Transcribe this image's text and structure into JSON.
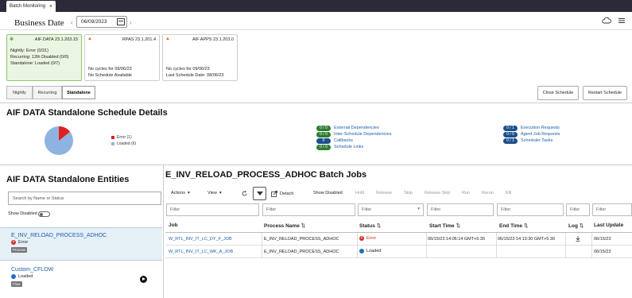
{
  "tab": {
    "title": "Batch Monitoring"
  },
  "header": {
    "title": "Business Date",
    "date": "06/09/2023"
  },
  "cards": [
    {
      "title": "AIF DATA 23.1.203.15",
      "lines": [
        "Nightly:        Error (0/31)",
        "Recurring:   12th Disabled (0/0)",
        "Standalone: Loaded (0/7)"
      ]
    },
    {
      "title": "RPAS 23.1.201.4",
      "lines": [
        "No cycles for 09/06/23",
        "No Schedule Available"
      ]
    },
    {
      "title": "AIF APPS 23.1.203.0",
      "lines": [
        "No cycles for 09/06/23",
        "Last Schedule Date: 08/06/23"
      ]
    }
  ],
  "segments": [
    "Nightly",
    "Recurring",
    "Standalone"
  ],
  "actions": {
    "close": "Close Schedule",
    "restart": "Restart Schedule"
  },
  "details": {
    "title": "AIF DATA Standalone Schedule Details",
    "legend": [
      {
        "label": "Error (1)",
        "color": "#e02020"
      },
      {
        "label": "Loaded (6)",
        "color": "#8fb3e0"
      }
    ],
    "deps": [
      {
        "count": "0 / 0",
        "label": "External Dependencies"
      },
      {
        "count": "0 / 0",
        "label": "Inter-Schedule Dependencies"
      },
      {
        "count": "0",
        "label": "Callbacks"
      },
      {
        "count": "0 / 0",
        "label": "Schedule Links"
      }
    ],
    "reqs": [
      {
        "count": "0 / 1",
        "label": "Execution Requests"
      },
      {
        "count": "0 / 0",
        "label": "Agent Job Requests"
      },
      {
        "count": "0 / 1",
        "label": "Scheduler Tasks"
      }
    ]
  },
  "entities": {
    "title": "AIF DATA Standalone Entities",
    "search_placeholder": "Search by Name or Status",
    "show_disabled": "Show Disabled",
    "items": [
      {
        "name": "E_INV_RELOAD_PROCESS_ADHOC",
        "status": "Error",
        "tag": "Process"
      },
      {
        "name": "Custom_CFLOW",
        "status": "Loaded",
        "tag": "Flow"
      }
    ]
  },
  "jobs": {
    "title": "E_INV_RELOAD_PROCESS_ADHOC Batch Jobs",
    "toolbar": {
      "actions": "Actions",
      "view": "View",
      "detach": "Detach",
      "show_disabled": "Show Disabled",
      "hold": "Hold",
      "release": "Release",
      "skip": "Skip",
      "release_skip": "Release Skip",
      "run": "Run",
      "rerun": "Rerun",
      "kill": "Kill"
    },
    "filter_placeholder": "Filter",
    "columns": [
      "Job",
      "Process Name",
      "Status",
      "Start Time",
      "End Time",
      "Log",
      "Last Update"
    ],
    "rows": [
      {
        "job": "W_RTL_INV_IT_LC_DY_F_JOB",
        "process": "E_INV_RELOAD_PROCESS_ADHOC",
        "status": "Error",
        "start": "06/15/23 14:06:14 GMT+5:30",
        "end": "06/15/23 14:13:30 GMT+5:30",
        "last": "06/15/23"
      },
      {
        "job": "W_RTL_INV_IT_LC_WK_A_JOB",
        "process": "E_INV_RELOAD_PROCESS_ADHOC",
        "status": "Loaded",
        "start": "",
        "end": "",
        "last": "06/15/23"
      }
    ]
  },
  "icons": [
    "cloud-icon",
    "menu-icon",
    "calendar-icon",
    "filter-icon",
    "refresh-icon",
    "detach-icon",
    "download-icon",
    "play-icon"
  ]
}
